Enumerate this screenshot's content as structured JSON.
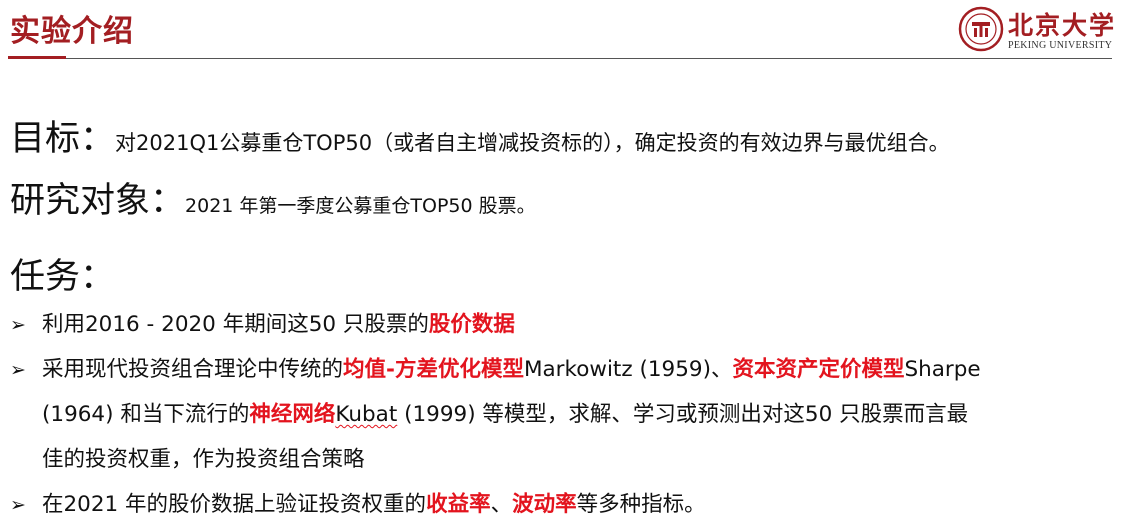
{
  "header": {
    "title": "实验介绍",
    "logo_cn": "北京大学",
    "logo_en": "PEKING UNIVERSITY",
    "brand_color": "#a31e22"
  },
  "goal": {
    "label": "目标：",
    "text": "对2021Q1公募重仓TOP50（或者自主增减投资标的），确定投资的有效边界与最优组合。"
  },
  "subject": {
    "label": "研究对象：",
    "text": "2021 年第一季度公募重仓TOP50 股票。"
  },
  "tasks": {
    "label": "任务：",
    "highlight_color": "#e3141e",
    "bullet_icon": "arrow-bullet-icon",
    "items": [
      {
        "before": "利用2016 - 2020 年期间这50 只股票的",
        "hl": "股价数据"
      },
      {
        "line1_a": "采用现代投资组合理论中传统的",
        "line1_hl1": "均值-方差优化模型",
        "line1_b": "Markowitz (1959)、",
        "line1_hl2": "资本资产定价模型",
        "line1_c": "Sharpe",
        "line2_a": "(1964) 和当下流行的",
        "line2_hl": "神经网络",
        "line2_b": "Kubat",
        "line2_c": " (1999) 等模型，求解、学习或预测出对这50 只股票而言最",
        "line3": "佳的投资权重，作为投资组合策略"
      },
      {
        "before": "在2021 年的股价数据上验证投资权重的",
        "hl1": "收益率",
        "mid": "、",
        "hl2": "波动率",
        "after": "等多种指标。"
      }
    ]
  }
}
